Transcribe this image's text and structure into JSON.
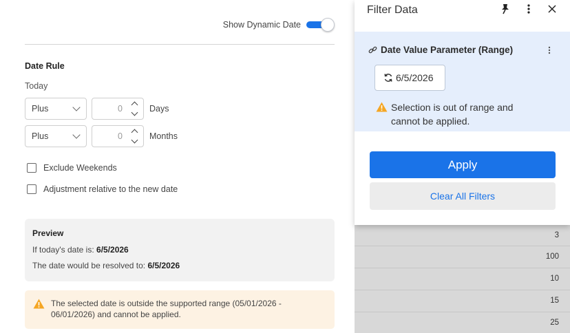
{
  "toggle": {
    "label": "Show Dynamic Date",
    "on": true
  },
  "date_rule": {
    "title": "Date Rule",
    "base": "Today",
    "rows": [
      {
        "operator": "Plus",
        "value": "0",
        "unit": "Days"
      },
      {
        "operator": "Plus",
        "value": "0",
        "unit": "Months"
      }
    ]
  },
  "options": [
    {
      "label": "Exclude Weekends",
      "checked": false
    },
    {
      "label": "Adjustment relative to the new date",
      "checked": false
    }
  ],
  "preview": {
    "title": "Preview",
    "today_prefix": "If today's date is:",
    "today_value": "6/5/2026",
    "resolved_prefix": "The date would be resolved to:",
    "resolved_value": "6/5/2026"
  },
  "warning": {
    "line1": "The selected date is outside the supported range (05/01/2026 -",
    "line2": "06/01/2026) and cannot be applied."
  },
  "filter_panel": {
    "title": "Filter Data",
    "icons": [
      "pin-icon",
      "more-vertical-icon",
      "close-icon"
    ],
    "param": {
      "title": "Date Value Parameter (Range)",
      "date": "6/5/2026",
      "warning_line1": "Selection is out of range and",
      "warning_line2": "cannot be applied."
    },
    "apply_label": "Apply",
    "clear_label": "Clear All Filters"
  },
  "grid_values": [
    "3",
    "100",
    "10",
    "15",
    "25"
  ],
  "colors": {
    "accent": "#1a73e8",
    "param_bg": "#e5eefc",
    "warning": "#f5a623",
    "warning_bg": "#fdf2e3"
  }
}
